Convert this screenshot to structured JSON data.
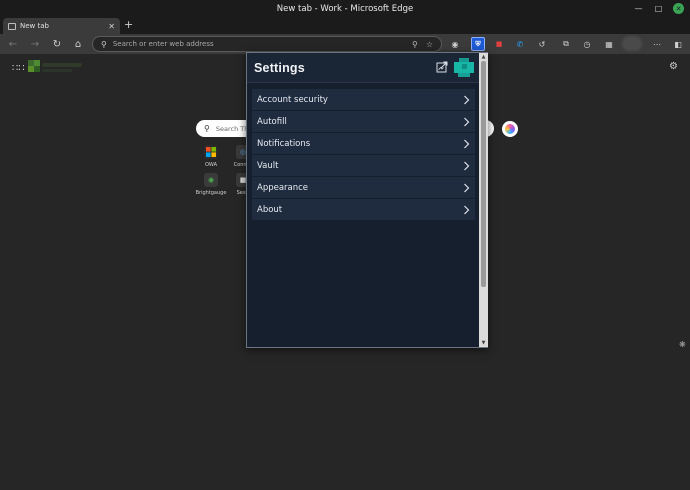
{
  "window": {
    "title": "New tab - Work - Microsoft Edge"
  },
  "tabs": [
    {
      "label": "New tab"
    }
  ],
  "address_bar": {
    "placeholder": "Search or enter web address"
  },
  "new_tab_page": {
    "search_placeholder": "Search Th",
    "quick_links": [
      {
        "label": "OWA"
      },
      {
        "label": "Connec"
      },
      {
        "label": "Brightgauge"
      },
      {
        "label": "Sessi"
      }
    ]
  },
  "bitwarden_popup": {
    "title": "Settings",
    "items": [
      {
        "label": "Account security"
      },
      {
        "label": "Autofill"
      },
      {
        "label": "Notifications"
      },
      {
        "label": "Vault"
      },
      {
        "label": "Appearance"
      },
      {
        "label": "About"
      }
    ]
  },
  "colors": {
    "popup_bg": "#151f2e",
    "popup_item_bg": "#1f2b3e",
    "bitwarden_blue": "#1e5bd6",
    "avatar_teal": "#17b6a6"
  }
}
